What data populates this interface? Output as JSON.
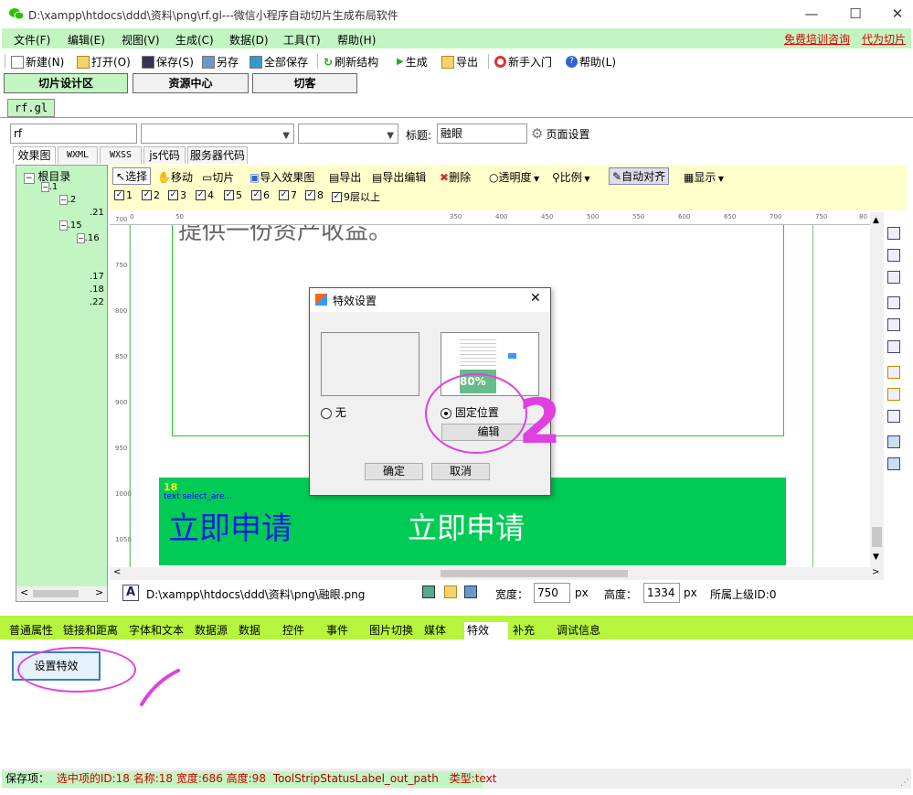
{
  "window": {
    "title": "D:\\xampp\\htdocs\\ddd\\资料\\png\\rf.gl---微信小程序自动切片生成布局软件",
    "min": "—",
    "max": "☐",
    "close": "✕"
  },
  "menu": {
    "items": [
      "文件(F)",
      "编辑(E)",
      "视图(V)",
      "生成(C)",
      "数据(D)",
      "工具(T)",
      "帮助(H)"
    ],
    "links": [
      "免费培训咨询",
      "代为切片"
    ]
  },
  "toolbar": {
    "items": [
      "新建(N)",
      "打开(O)",
      "保存(S)",
      "另存",
      "全部保存",
      "刷新结构",
      "生成",
      "导出",
      "新手入门",
      "帮助(L)"
    ]
  },
  "main_tabs": [
    "切片设计区",
    "资源中心",
    "切客"
  ],
  "file_tab": "rf.gl",
  "props": {
    "name_value": "rf",
    "title_label": "标题:",
    "title_value": "融眼",
    "page_settings": "页面设置"
  },
  "code_tabs": [
    "效果图",
    "WXML",
    "WXSS",
    "js代码",
    "服务器代码"
  ],
  "tree": {
    "root": "根目录",
    "nodes": [
      ".1",
      ".2",
      ".21",
      ".15",
      ".16",
      ".17",
      ".18",
      ".22"
    ]
  },
  "design_toolbar": {
    "items": [
      "选择",
      "移动",
      "切片",
      "导入效果图",
      "导出",
      "导出编辑",
      "删除",
      "透明度",
      "比例",
      "自动对齐",
      "显示"
    ],
    "layers": [
      "1",
      "2",
      "3",
      "4",
      "5",
      "6",
      "7",
      "8",
      "9层以上"
    ]
  },
  "ruler": {
    "top": [
      "0",
      "50",
      "350",
      "400",
      "450",
      "500",
      "550",
      "600",
      "650",
      "700",
      "750",
      "80"
    ],
    "left": [
      "700",
      "750",
      "800",
      "850",
      "900",
      "950",
      "1000",
      "1050"
    ]
  },
  "canvas": {
    "intro_text": "提供一份资产收益。",
    "selected_id": "18",
    "selected_name": "text select_are...",
    "apply_text_1": "立即申请",
    "apply_text_2": "立即申请"
  },
  "pathbar": {
    "path": "D:\\xampp\\htdocs\\ddd\\资料\\png\\融眼.png",
    "width_label": "宽度：",
    "width_value": "750",
    "width_unit": "px",
    "height_label": "高度：",
    "height_value": "1334",
    "height_unit": "px",
    "parent_label": "所属上级ID:0"
  },
  "dialog": {
    "title": "特效设置",
    "close": "✕",
    "option_none": "无",
    "option_fixed": "固定位置",
    "edit_button": "编辑",
    "ok_button": "确定",
    "cancel_button": "取消",
    "preview_percent": "80%"
  },
  "prop_tabs": [
    "普通属性",
    "链接和距离",
    "字体和文本",
    "数据源",
    "数据",
    "控件",
    "事件",
    "图片切换",
    "媒体",
    "特效",
    "补充",
    "调试信息"
  ],
  "active_prop_tab": "特效",
  "set_effect_button": "设置特效",
  "statusbar": {
    "label": "保存项：",
    "selected_info": "选中项的ID:18 名称:18 宽度:686 高度:98",
    "out_path": "ToolStripStatusLabel_out_path",
    "type": "类型:text"
  },
  "annotations": [
    "1",
    "2"
  ],
  "colors": {
    "menu_bg": "#c2f5c2",
    "accent_green": "#b6f53b",
    "design_toolbar_bg": "#ffffcc",
    "apply_bar": "#00cc55",
    "annotation": "#e040e0"
  }
}
